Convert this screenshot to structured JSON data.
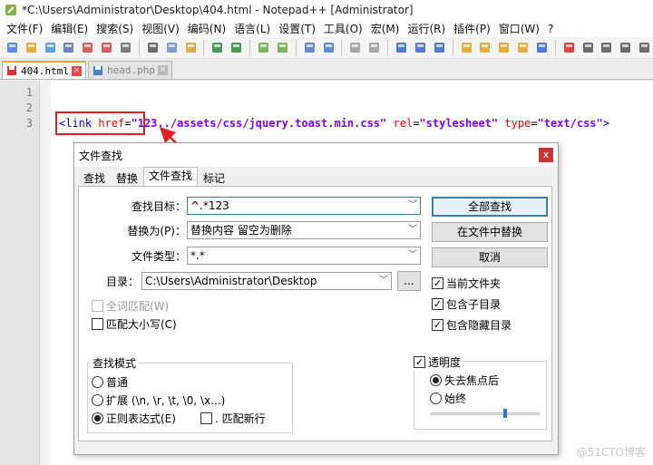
{
  "window": {
    "title": "*C:\\Users\\Administrator\\Desktop\\404.html - Notepad++ [Administrator]"
  },
  "menu": [
    "文件(F)",
    "编辑(E)",
    "搜索(S)",
    "视图(V)",
    "编码(N)",
    "语言(L)",
    "设置(T)",
    "工具(O)",
    "宏(M)",
    "运行(R)",
    "插件(P)",
    "窗口(W)",
    "?"
  ],
  "toolbar_icons": [
    "new-file",
    "open-file",
    "save",
    "save-all",
    "close",
    "close-all",
    "print",
    "cut",
    "copy",
    "paste",
    "undo",
    "redo",
    "find",
    "replace",
    "zoom-in",
    "zoom-out",
    "sync-v",
    "sync-h",
    "word-wrap",
    "show-all-chars",
    "indent-guide",
    "udl",
    "doc-map",
    "function-list",
    "folder-workspace",
    "monitor",
    "record-macro",
    "stop-macro",
    "play-macro",
    "run-macro-multiple",
    "save-macro"
  ],
  "tabs": [
    {
      "label": "404.html",
      "active": true
    },
    {
      "label": "head.php",
      "active": false
    }
  ],
  "editor": {
    "line_numbers": [
      "1",
      "2",
      "3"
    ],
    "line3": {
      "open": "<link",
      "attr_href": "href",
      "eq1": "=",
      "val_href": "\"123../assets/css/jquery.toast.min.css\"",
      "attr_rel": "rel",
      "eq2": "=",
      "val_rel": "\"stylesheet\"",
      "attr_type": "type",
      "eq3": "=",
      "val_type": "\"text/css\"",
      "tail": ">"
    }
  },
  "annotation_color": "#e02020",
  "dialog": {
    "title": "文件查找",
    "close": "x",
    "tabs": [
      "查找",
      "替换",
      "文件查找",
      "标记"
    ],
    "active_tab": "文件查找",
    "find_label": "查找目标：",
    "find_value": "^.*123",
    "replace_label": "替换为(P)：",
    "replace_value": "替换内容  留空为删除",
    "filter_label": "文件类型：",
    "filter_value": "*.*",
    "dir_label": "目录：",
    "dir_value": "C:\\Users\\Administrator\\Desktop",
    "browse": "...",
    "buttons": {
      "find_all": "全部查找",
      "replace_in_files": "在文件中替换",
      "cancel": "取消"
    },
    "options": {
      "whole_word": "全词匹配(W)",
      "match_case": "匹配大小写(C)",
      "current_folder": "当前文件夹",
      "sub_folders": "包含子目录",
      "hidden_folders": "包含隐藏目录"
    },
    "search_mode": {
      "title": "查找模式",
      "normal": "普通",
      "extended": "扩展 (\\n, \\r, \\t, \\0, \\x...)",
      "regex": "正则表达式(E)",
      "dot_newline": ". 匹配新行",
      "selected": "regex"
    },
    "transparency": {
      "title": "透明度",
      "on_lose_focus": "失去焦点后",
      "always": "始终",
      "selected": "on_lose_focus",
      "level": 0.68
    }
  },
  "watermark": "@51CTO博客"
}
